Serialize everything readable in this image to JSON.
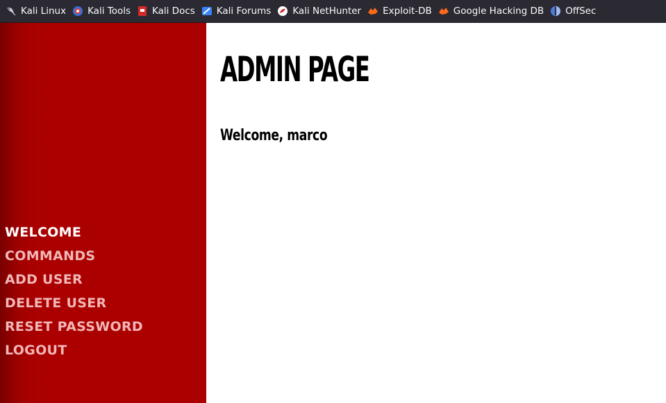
{
  "bookmarks": [
    {
      "label": "Kali Linux",
      "icon": "kali-dragon-icon"
    },
    {
      "label": "Kali Tools",
      "icon": "kali-tools-icon"
    },
    {
      "label": "Kali Docs",
      "icon": "kali-docs-icon"
    },
    {
      "label": "Kali Forums",
      "icon": "kali-forums-icon"
    },
    {
      "label": "Kali NetHunter",
      "icon": "kali-nethunter-icon"
    },
    {
      "label": "Exploit-DB",
      "icon": "exploit-db-icon"
    },
    {
      "label": "Google Hacking DB",
      "icon": "google-hacking-db-icon"
    },
    {
      "label": "OffSec",
      "icon": "offsec-icon"
    }
  ],
  "sidebar": {
    "items": [
      {
        "label": "WELCOME",
        "active": true
      },
      {
        "label": "COMMANDS",
        "active": false
      },
      {
        "label": "ADD USER",
        "active": false
      },
      {
        "label": "DELETE USER",
        "active": false
      },
      {
        "label": "RESET PASSWORD",
        "active": false
      },
      {
        "label": "LOGOUT",
        "active": false
      }
    ]
  },
  "main": {
    "title": "ADMIN PAGE",
    "welcome": "Welcome, marco"
  },
  "colors": {
    "sidebar": "#ab0000",
    "toolbar": "#2b2a33",
    "nav_active": "#ffffff",
    "nav_inactive": "#f2b7b7"
  }
}
